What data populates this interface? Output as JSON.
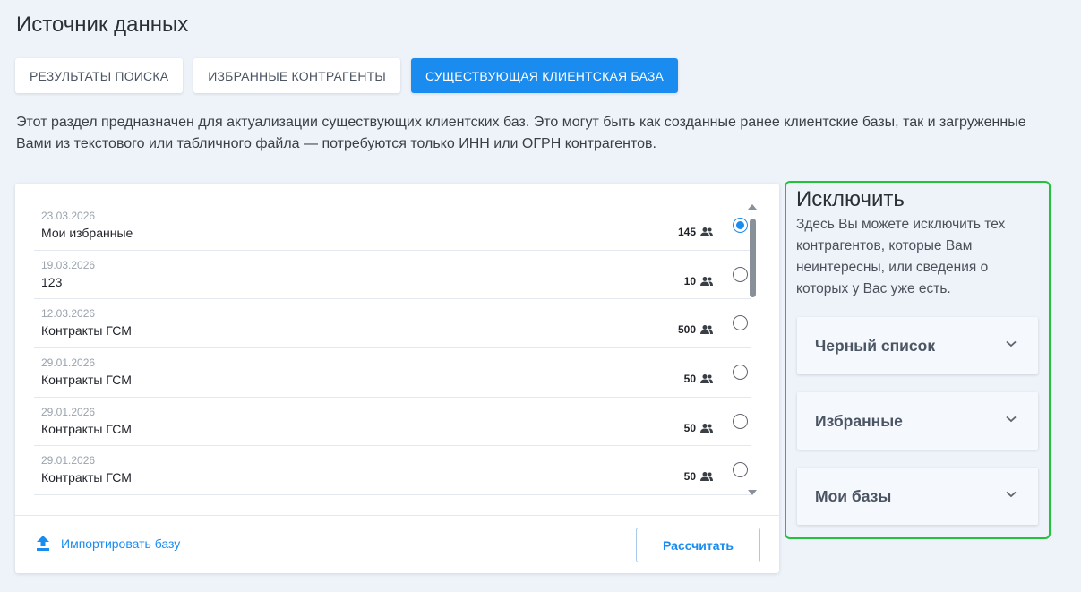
{
  "header": {
    "title": "Источник данных"
  },
  "tabs": [
    {
      "label": "РЕЗУЛЬТАТЫ ПОИСКА",
      "active": false
    },
    {
      "label": "ИЗБРАННЫЕ КОНТРАГЕНТЫ",
      "active": false
    },
    {
      "label": "СУЩЕСТВУЮЩАЯ КЛИЕНТСКАЯ БАЗА",
      "active": true
    }
  ],
  "description": "Этот раздел предназначен для актуализации существующих клиентских баз. Это могут быть как созданные ранее клиентские базы, так и загруженные Вами из текстового или табличного файла — потребуются только ИНН или ОГРН контрагентов.",
  "bases": [
    {
      "date": "23.03.2026",
      "name": "Мои избранные",
      "count": "145",
      "selected": true
    },
    {
      "date": "19.03.2026",
      "name": "123",
      "count": "10",
      "selected": false
    },
    {
      "date": "12.03.2026",
      "name": "Контракты ГСМ",
      "count": "500",
      "selected": false
    },
    {
      "date": "29.01.2026",
      "name": "Контракты ГСМ",
      "count": "50",
      "selected": false
    },
    {
      "date": "29.01.2026",
      "name": "Контракты ГСМ",
      "count": "50",
      "selected": false
    },
    {
      "date": "29.01.2026",
      "name": "Контракты ГСМ",
      "count": "50",
      "selected": false
    }
  ],
  "footer": {
    "import_label": "Импортировать базу",
    "calculate_label": "Рассчитать"
  },
  "exclude": {
    "title": "Исключить",
    "text": "Здесь Вы можете исключить тех контрагентов, которые Вам неинтересны, или сведения о которых у Вас уже есть.",
    "sections": [
      {
        "label": "Черный список"
      },
      {
        "label": "Избранные"
      },
      {
        "label": "Мои базы"
      }
    ]
  },
  "colors": {
    "accent": "#1a8cf0",
    "highlight_border": "#22c33a",
    "background": "#eef3fa"
  },
  "icons": {
    "people": "people-icon",
    "upload": "upload-icon",
    "chevron": "chevron-down-icon"
  }
}
